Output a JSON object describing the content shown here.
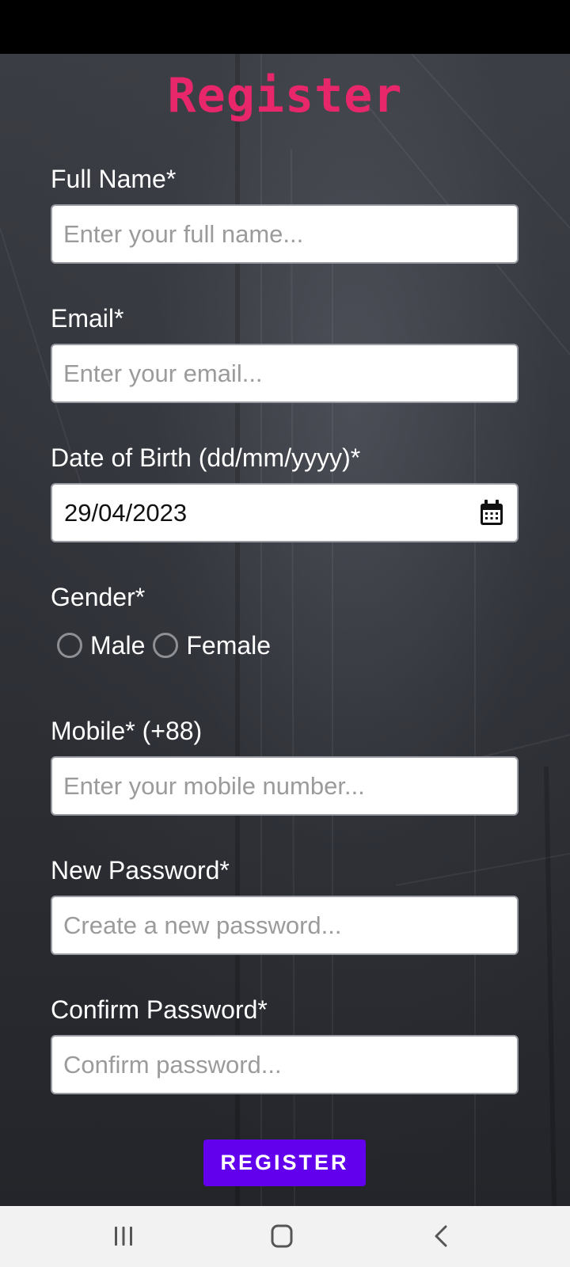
{
  "form": {
    "title": "Register",
    "full_name": {
      "label": "Full Name*",
      "placeholder": "Enter your full name...",
      "value": ""
    },
    "email": {
      "label": "Email*",
      "placeholder": "Enter your email...",
      "value": ""
    },
    "dob": {
      "label": "Date of Birth (dd/mm/yyyy)*",
      "value": "29/04/2023",
      "icon": "calendar-icon"
    },
    "gender": {
      "label": "Gender*",
      "options": [
        "Male",
        "Female"
      ],
      "selected": null
    },
    "mobile": {
      "label": "Mobile* (+88)",
      "placeholder": "Enter your mobile number...",
      "value": ""
    },
    "new_password": {
      "label": "New Password*",
      "placeholder": "Create a new password...",
      "value": ""
    },
    "confirm_password": {
      "label": "Confirm Password*",
      "placeholder": "Confirm password...",
      "value": ""
    },
    "submit_label": "REGISTER"
  },
  "nav": {
    "icons": [
      "recent-apps-icon",
      "home-icon",
      "back-icon"
    ]
  },
  "colors": {
    "title": "#e8266a",
    "button": "#6200ee",
    "label": "#ffffff"
  }
}
